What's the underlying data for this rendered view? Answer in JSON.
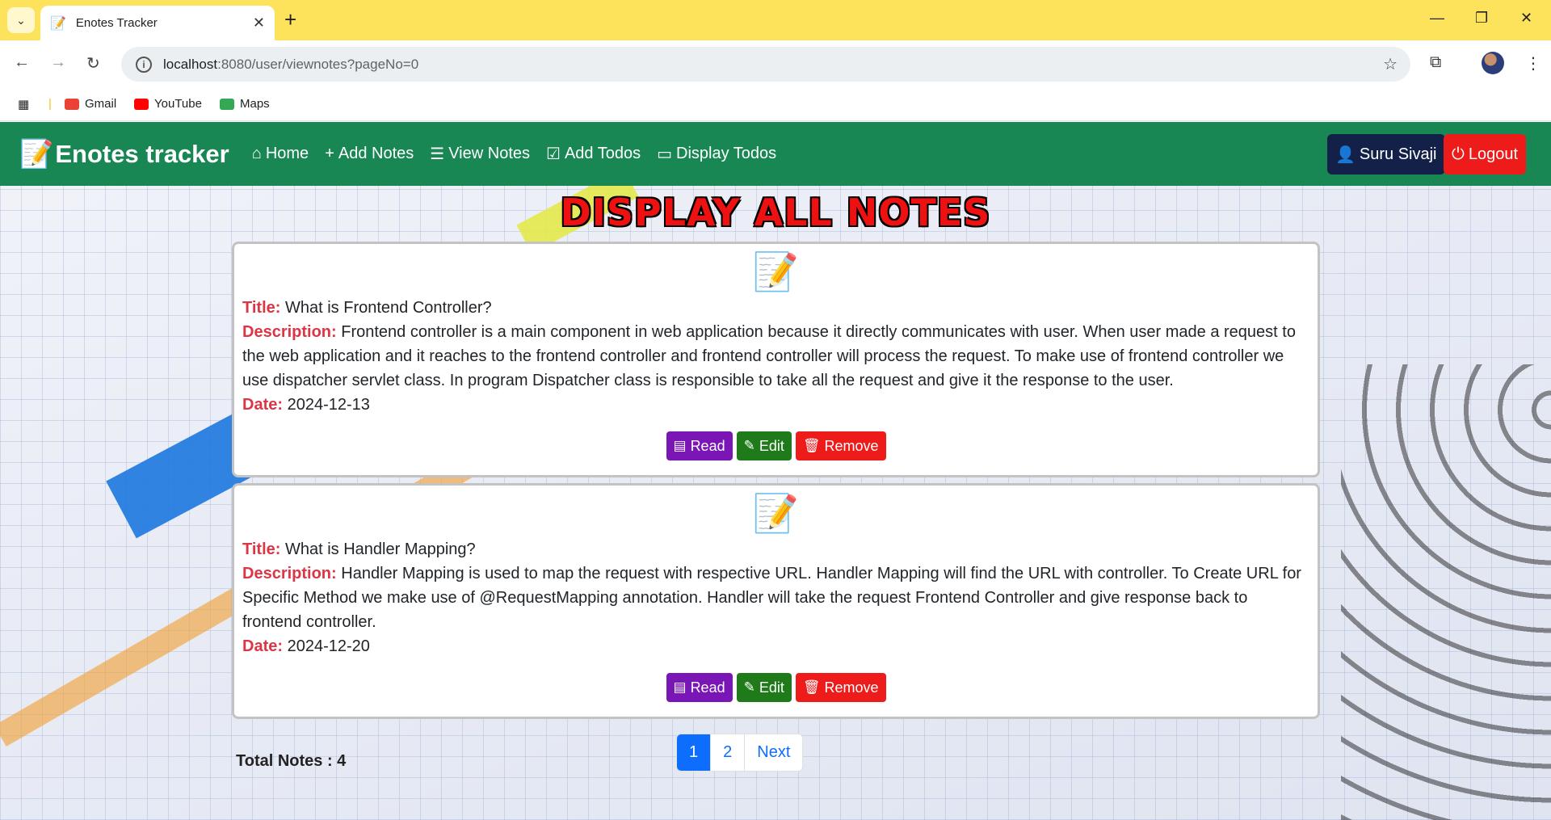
{
  "browser": {
    "tab_title": "Enotes Tracker",
    "url_host": "localhost",
    "url_path": ":8080/user/viewnotes?pageNo=0",
    "bookmarks": [
      {
        "label": "Gmail",
        "color": "#ea4335"
      },
      {
        "label": "YouTube",
        "color": "#ff0000"
      },
      {
        "label": "Maps",
        "color": "#34a853"
      }
    ]
  },
  "navbar": {
    "brand": "Enotes tracker",
    "items": [
      {
        "label": "Home",
        "icon": "home-icon"
      },
      {
        "label": "Add Notes",
        "icon": "plus-icon"
      },
      {
        "label": "View Notes",
        "icon": "list-icon"
      },
      {
        "label": "Add Todos",
        "icon": "calendar-check-icon"
      },
      {
        "label": "Display Todos",
        "icon": "desktop-icon"
      }
    ],
    "user_label": "Suru Sivaji",
    "logout_label": "Logout",
    "colors": {
      "navbar": "#198754",
      "user": "#132047",
      "logout": "#ee1b1b"
    }
  },
  "main": {
    "heading": "DISPLAY ALL NOTES",
    "labels": {
      "title": "Title:",
      "description": "Description:",
      "date": "Date:"
    },
    "notes": [
      {
        "title": "What is Frontend Controller?",
        "description": "Frontend controller is a main component in web application because it directly communicates with user. When user made a request to the web application and it reaches to the frontend controller and frontend controller will process the request. To make use of frontend controller we use dispatcher servlet class. In program Dispatcher class is responsible to take all the request and give it the response to the user.",
        "date": "2024-12-13"
      },
      {
        "title": "What is Handler Mapping?",
        "description": "Handler Mapping is used to map the request with respective URL. Handler Mapping will find the URL with controller. To Create URL for Specific Method we make use of @RequestMapping annotation. Handler will take the request Frontend Controller and give response back to frontend controller.",
        "date": "2024-12-20"
      }
    ],
    "buttons": {
      "read": "Read",
      "edit": "Edit",
      "remove": "Remove"
    },
    "total_notes": "Total Notes : 4",
    "pagination": {
      "pages": [
        "1",
        "2"
      ],
      "active": "1",
      "next": "Next"
    }
  }
}
